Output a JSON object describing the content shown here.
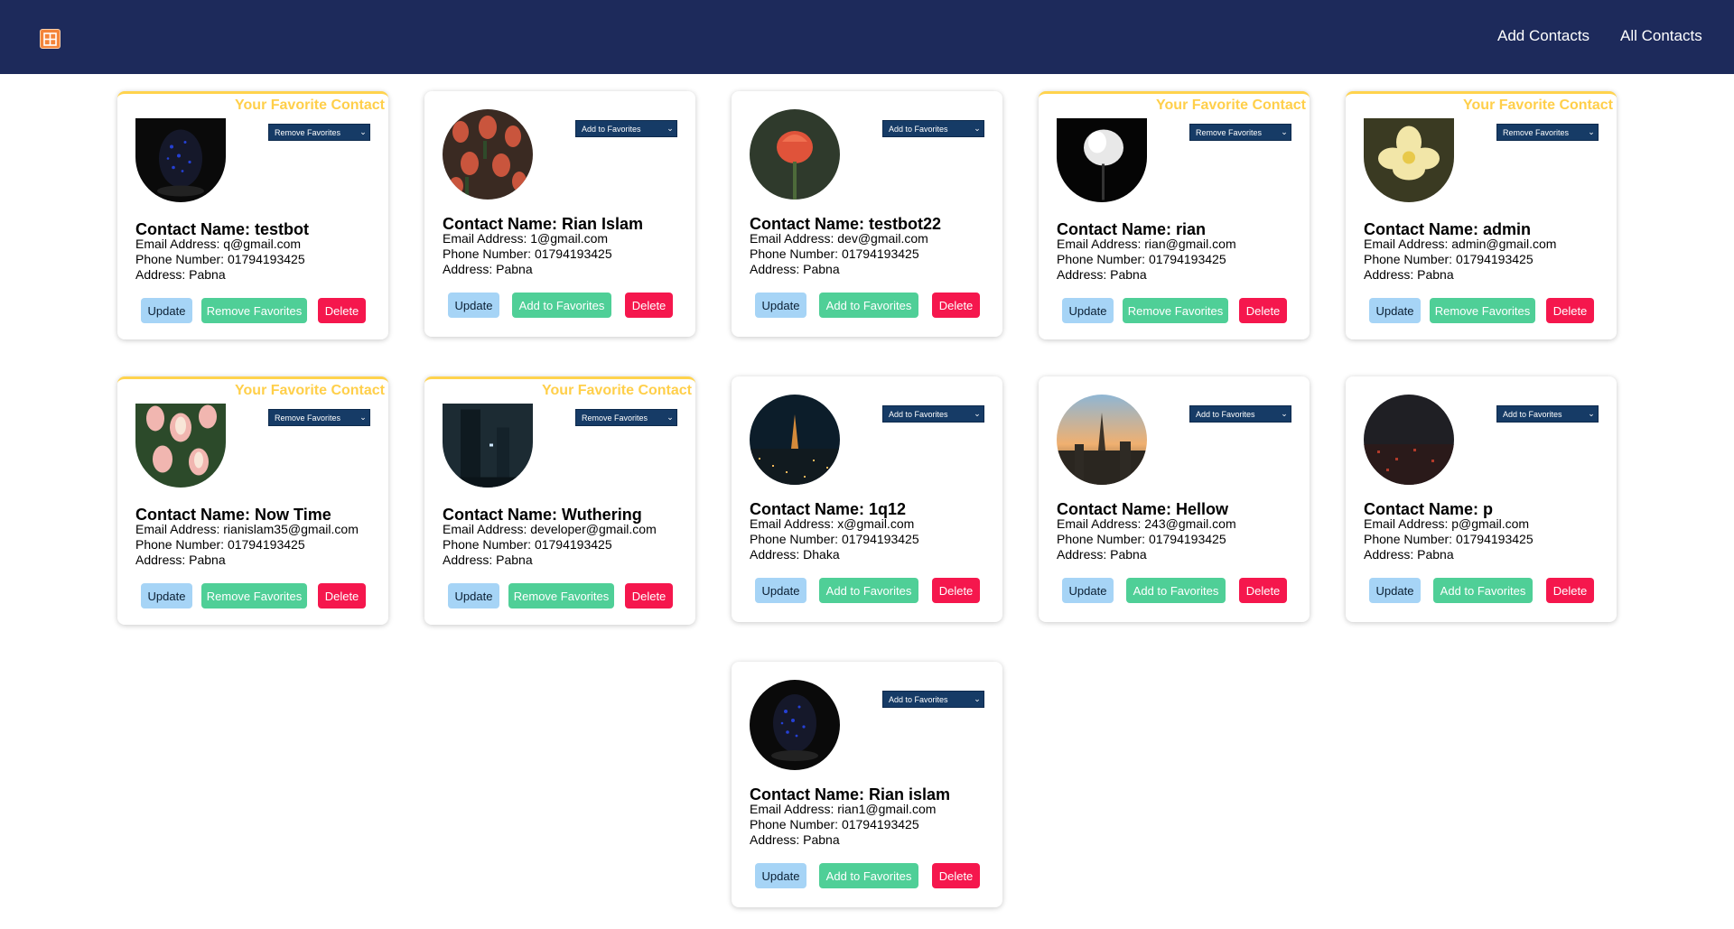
{
  "nav": {
    "add_contacts": "Add Contacts",
    "all_contacts": "All Contacts"
  },
  "labels": {
    "favorite_banner": "Your Favorite Contact",
    "name_prefix": "Contact Name: ",
    "email_prefix": "Email Address: ",
    "phone_prefix": "Phone Number: ",
    "address_prefix": "Address: ",
    "update": "Update",
    "delete": "Delete",
    "add_to_favorites": "Add to Favorites",
    "remove_favorites": "Remove Favorites"
  },
  "colors": {
    "navbar": "#1d2a5b",
    "favorite_gold": "#ffcf4a",
    "update_button": "#a6d4f6",
    "favorite_button": "#4fcf97",
    "delete_button": "#f5174d",
    "select_bg": "#163b66"
  },
  "contacts": [
    {
      "name": "testbot",
      "email": "q@gmail.com",
      "phone": "01794193425",
      "address": "Pabna",
      "favorite": true,
      "select_label": "Remove Favorites",
      "button_label": "Remove Favorites",
      "image": "dark-egg"
    },
    {
      "name": "Rian Islam",
      "email": "1@gmail.com",
      "phone": "01794193425",
      "address": "Pabna",
      "favorite": false,
      "select_label": "Add to Favorites",
      "button_label": "Add to Favorites",
      "image": "tulip-field"
    },
    {
      "name": "testbot22",
      "email": "dev@gmail.com",
      "phone": "01794193425",
      "address": "Pabna",
      "favorite": false,
      "select_label": "Add to Favorites",
      "button_label": "Add to Favorites",
      "image": "red-tulip"
    },
    {
      "name": "rian",
      "email": "rian@gmail.com",
      "phone": "01794193425",
      "address": "Pabna",
      "favorite": true,
      "select_label": "Remove Favorites",
      "button_label": "Remove Favorites",
      "image": "white-flower"
    },
    {
      "name": "admin",
      "email": "admin@gmail.com",
      "phone": "01794193425",
      "address": "Pabna",
      "favorite": true,
      "select_label": "Remove Favorites",
      "button_label": "Remove Favorites",
      "image": "yellow-flower"
    },
    {
      "name": "Now Time",
      "email": "rianislam35@gmail.com",
      "phone": "01794193425",
      "address": "Pabna",
      "favorite": true,
      "select_label": "Remove Favorites",
      "button_label": "Remove Favorites",
      "image": "pink-tulips"
    },
    {
      "name": "Wuthering",
      "email": "developer@gmail.com",
      "phone": "01794193425",
      "address": "Pabna",
      "favorite": true,
      "select_label": "Remove Favorites",
      "button_label": "Remove Favorites",
      "image": "night-tower"
    },
    {
      "name": "1q12",
      "email": "x@gmail.com",
      "phone": "01794193425",
      "address": "Dhaka",
      "favorite": false,
      "select_label": "Add to Favorites",
      "button_label": "Add to Favorites",
      "image": "city-night"
    },
    {
      "name": "Hellow",
      "email": "243@gmail.com",
      "phone": "01794193425",
      "address": "Pabna",
      "favorite": false,
      "select_label": "Add to Favorites",
      "button_label": "Add to Favorites",
      "image": "city-sunset"
    },
    {
      "name": "p",
      "email": "p@gmail.com",
      "phone": "01794193425",
      "address": "Pabna",
      "favorite": false,
      "select_label": "Add to Favorites",
      "button_label": "Add to Favorites",
      "image": "dark-city"
    },
    {
      "name": "Rian islam",
      "email": "rian1@gmail.com",
      "phone": "01794193425",
      "address": "Pabna",
      "favorite": false,
      "select_label": "Add to Favorites",
      "button_label": "Add to Favorites",
      "image": "dark-egg"
    }
  ]
}
